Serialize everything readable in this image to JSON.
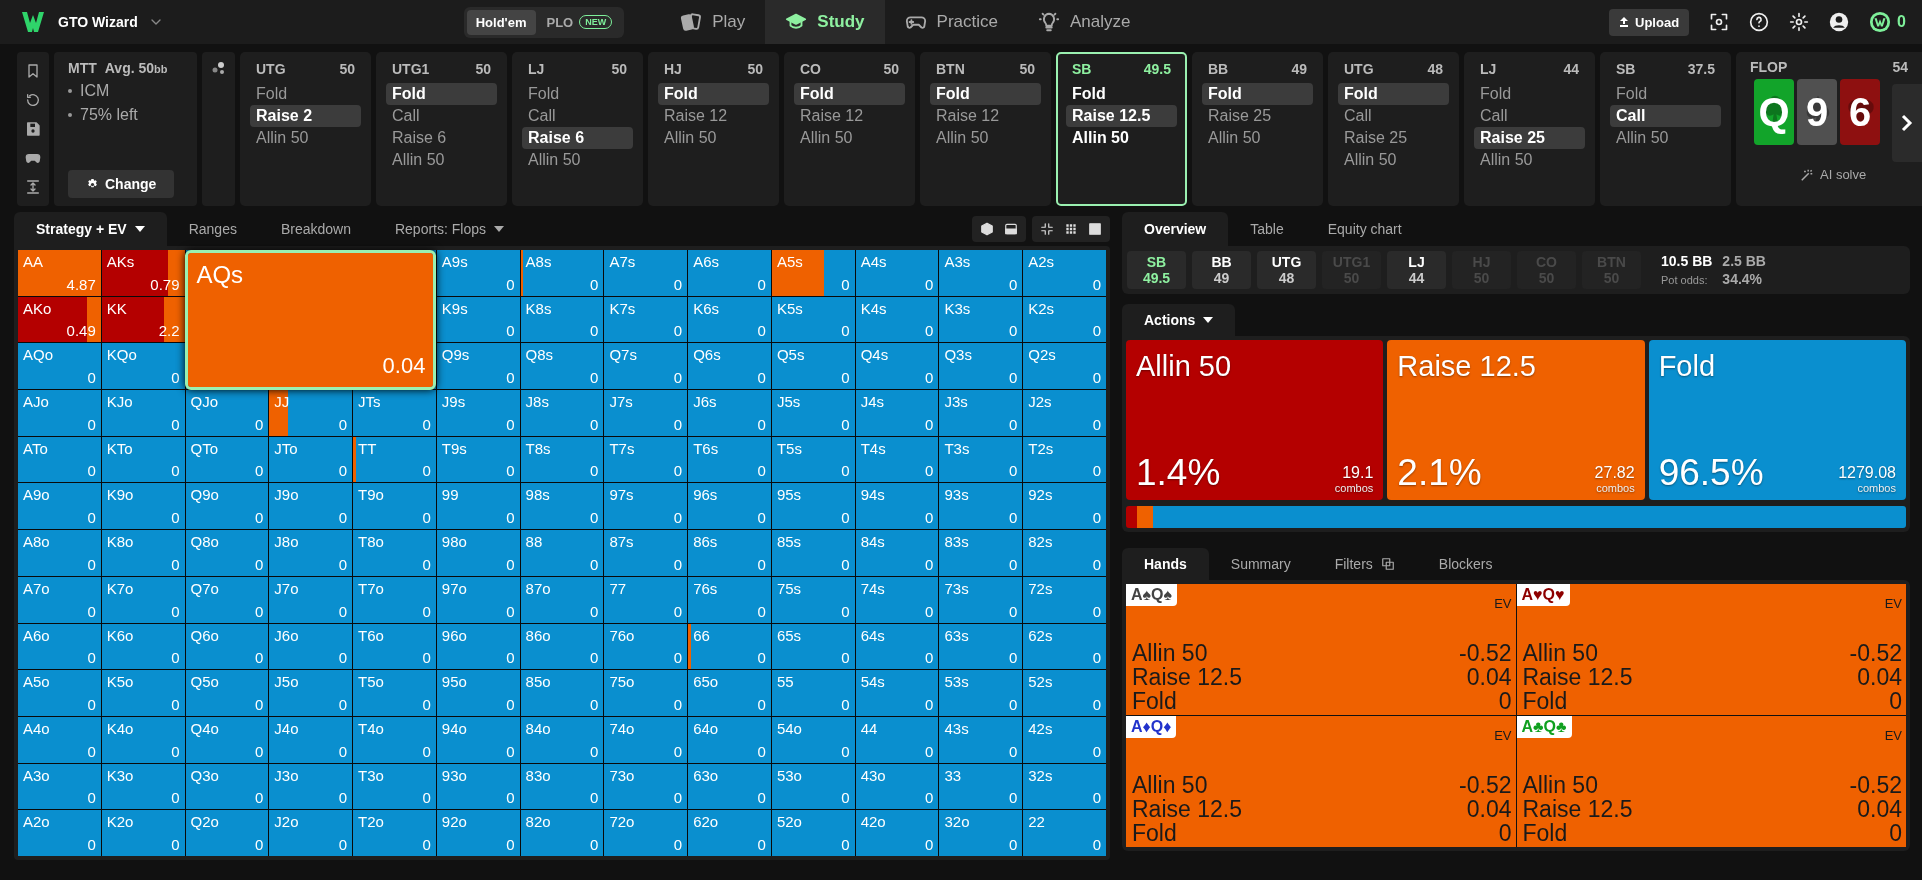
{
  "top_bar": {
    "app_name": "GTO Wizard",
    "game_toggle": [
      {
        "label": "Hold'em",
        "selected": true
      },
      {
        "label": "PLO",
        "badge": "NEW",
        "selected": false
      }
    ],
    "nav": [
      {
        "label": "Play",
        "kind": "cards",
        "selected": false
      },
      {
        "label": "Study",
        "kind": "cap",
        "selected": true
      },
      {
        "label": "Practice",
        "kind": "gamepad",
        "selected": false
      },
      {
        "label": "Analyze",
        "kind": "bulb",
        "selected": false
      }
    ],
    "upload": "Upload",
    "coins": "0"
  },
  "history": {
    "format": "MTT",
    "avg": "Avg. 50",
    "avg_unit": "bb",
    "notes": [
      "ICM",
      "75% left"
    ],
    "change_button": "Change",
    "steps": [
      {
        "position": "UTG",
        "stack": "50",
        "current": false,
        "actions": [
          {
            "label": "Fold",
            "selected": false
          },
          {
            "label": "Raise 2",
            "selected": true
          },
          {
            "label": "Allin 50",
            "selected": false
          }
        ]
      },
      {
        "position": "UTG1",
        "stack": "50",
        "current": false,
        "actions": [
          {
            "label": "Fold",
            "selected": true
          },
          {
            "label": "Call",
            "selected": false
          },
          {
            "label": "Raise 6",
            "selected": false
          },
          {
            "label": "Allin 50",
            "selected": false
          }
        ]
      },
      {
        "position": "LJ",
        "stack": "50",
        "current": false,
        "actions": [
          {
            "label": "Fold",
            "selected": false
          },
          {
            "label": "Call",
            "selected": false
          },
          {
            "label": "Raise 6",
            "selected": true
          },
          {
            "label": "Allin 50",
            "selected": false
          }
        ]
      },
      {
        "position": "HJ",
        "stack": "50",
        "current": false,
        "actions": [
          {
            "label": "Fold",
            "selected": true
          },
          {
            "label": "Raise 12",
            "selected": false
          },
          {
            "label": "Allin 50",
            "selected": false
          }
        ]
      },
      {
        "position": "CO",
        "stack": "50",
        "current": false,
        "actions": [
          {
            "label": "Fold",
            "selected": true
          },
          {
            "label": "Raise 12",
            "selected": false
          },
          {
            "label": "Allin 50",
            "selected": false
          }
        ]
      },
      {
        "position": "BTN",
        "stack": "50",
        "current": false,
        "actions": [
          {
            "label": "Fold",
            "selected": true
          },
          {
            "label": "Raise 12",
            "selected": false
          },
          {
            "label": "Allin 50",
            "selected": false
          }
        ]
      },
      {
        "position": "SB",
        "stack": "49.5",
        "current": true,
        "actions": [
          {
            "label": "Fold",
            "selected": false
          },
          {
            "label": "Raise 12.5",
            "selected": true
          },
          {
            "label": "Allin 50",
            "selected": false
          }
        ]
      },
      {
        "position": "BB",
        "stack": "49",
        "current": false,
        "actions": [
          {
            "label": "Fold",
            "selected": true
          },
          {
            "label": "Raise 25",
            "selected": false
          },
          {
            "label": "Allin 50",
            "selected": false
          }
        ]
      },
      {
        "position": "UTG",
        "stack": "48",
        "current": false,
        "actions": [
          {
            "label": "Fold",
            "selected": true
          },
          {
            "label": "Call",
            "selected": false
          },
          {
            "label": "Raise 25",
            "selected": false
          },
          {
            "label": "Allin 50",
            "selected": false
          }
        ]
      },
      {
        "position": "LJ",
        "stack": "44",
        "current": false,
        "actions": [
          {
            "label": "Fold",
            "selected": false
          },
          {
            "label": "Call",
            "selected": false
          },
          {
            "label": "Raise 25",
            "selected": true
          },
          {
            "label": "Allin 50",
            "selected": false
          }
        ]
      },
      {
        "position": "SB",
        "stack": "37.5",
        "current": false,
        "actions": [
          {
            "label": "Fold",
            "selected": false
          },
          {
            "label": "Call",
            "selected": true
          },
          {
            "label": "Allin 50",
            "selected": false
          }
        ]
      }
    ],
    "board": {
      "street": "FLOP",
      "pot": "54",
      "cards": [
        {
          "rank": "Q",
          "kind": "club",
          "color": "#12a42a"
        },
        {
          "rank": "9",
          "kind": "spade",
          "color": "#505050"
        },
        {
          "rank": "6",
          "kind": "heart",
          "color": "#8e1010"
        }
      ],
      "ai_solve": "AI solve"
    }
  },
  "left_tabs": [
    {
      "label": "Strategy + EV",
      "dropdown": true,
      "selected": true
    },
    {
      "label": "Ranges",
      "dropdown": false,
      "selected": false
    },
    {
      "label": "Breakdown",
      "dropdown": false,
      "selected": false
    },
    {
      "label": "Reports: Flops",
      "dropdown": true,
      "selected": false
    }
  ],
  "hand_grid": {
    "rows": [
      [
        {
          "hand": "AA",
          "ev": "4.87",
          "mix": [
            {
              "kind": "raise",
              "level": 1
            }
          ]
        },
        {
          "hand": "AKs",
          "ev": "0.79",
          "mix": [
            {
              "kind": "allin",
              "level": 0.8
            },
            {
              "kind": "raise",
              "level": 0.2
            }
          ]
        },
        null,
        null,
        null,
        {
          "hand": "A9s",
          "ev": "0"
        },
        {
          "hand": "A8s",
          "ev": "0",
          "mix": [
            {
              "kind": "raise",
              "level": 0.03
            }
          ]
        },
        {
          "hand": "A7s",
          "ev": "0"
        },
        {
          "hand": "A6s",
          "ev": "0"
        },
        {
          "hand": "A5s",
          "ev": "0",
          "mix": [
            {
              "kind": "raise",
              "level": 0.63
            }
          ]
        },
        {
          "hand": "A4s",
          "ev": "0"
        },
        {
          "hand": "A3s",
          "ev": "0"
        },
        {
          "hand": "A2s",
          "ev": "0"
        }
      ],
      [
        {
          "hand": "AKo",
          "ev": "0.49",
          "mix": [
            {
              "kind": "allin",
              "level": 0.83
            },
            {
              "kind": "raise",
              "level": 0.17
            }
          ]
        },
        {
          "hand": "KK",
          "ev": "2.2",
          "mix": [
            {
              "kind": "allin",
              "level": 0.75
            },
            {
              "kind": "raise",
              "level": 0.25
            }
          ]
        },
        null,
        null,
        null,
        {
          "hand": "K9s",
          "ev": "0"
        },
        {
          "hand": "K8s",
          "ev": "0"
        },
        {
          "hand": "K7s",
          "ev": "0"
        },
        {
          "hand": "K6s",
          "ev": "0"
        },
        {
          "hand": "K5s",
          "ev": "0"
        },
        {
          "hand": "K4s",
          "ev": "0"
        },
        {
          "hand": "K3s",
          "ev": "0"
        },
        {
          "hand": "K2s",
          "ev": "0"
        }
      ],
      [
        {
          "hand": "AQo",
          "ev": "0"
        },
        {
          "hand": "KQo",
          "ev": "0"
        },
        null,
        null,
        null,
        {
          "hand": "Q9s",
          "ev": "0"
        },
        {
          "hand": "Q8s",
          "ev": "0"
        },
        {
          "hand": "Q7s",
          "ev": "0"
        },
        {
          "hand": "Q6s",
          "ev": "0"
        },
        {
          "hand": "Q5s",
          "ev": "0"
        },
        {
          "hand": "Q4s",
          "ev": "0"
        },
        {
          "hand": "Q3s",
          "ev": "0"
        },
        {
          "hand": "Q2s",
          "ev": "0"
        }
      ],
      [
        {
          "hand": "AJo",
          "ev": "0"
        },
        {
          "hand": "KJo",
          "ev": "0"
        },
        {
          "hand": "QJo",
          "ev": "0"
        },
        {
          "hand": "JJ",
          "ev": "0",
          "mix": [
            {
              "kind": "raise",
              "level": 0.22
            }
          ]
        },
        {
          "hand": "JTs",
          "ev": "0"
        },
        {
          "hand": "J9s",
          "ev": "0"
        },
        {
          "hand": "J8s",
          "ev": "0"
        },
        {
          "hand": "J7s",
          "ev": "0"
        },
        {
          "hand": "J6s",
          "ev": "0"
        },
        {
          "hand": "J5s",
          "ev": "0"
        },
        {
          "hand": "J4s",
          "ev": "0"
        },
        {
          "hand": "J3s",
          "ev": "0"
        },
        {
          "hand": "J2s",
          "ev": "0"
        }
      ],
      [
        {
          "hand": "ATo",
          "ev": "0"
        },
        {
          "hand": "KTo",
          "ev": "0"
        },
        {
          "hand": "QTo",
          "ev": "0"
        },
        {
          "hand": "JTo",
          "ev": "0"
        },
        {
          "hand": "TT",
          "ev": "0",
          "mix": [
            {
              "kind": "raise",
              "level": 0.03
            }
          ]
        },
        {
          "hand": "T9s",
          "ev": "0"
        },
        {
          "hand": "T8s",
          "ev": "0"
        },
        {
          "hand": "T7s",
          "ev": "0"
        },
        {
          "hand": "T6s",
          "ev": "0"
        },
        {
          "hand": "T5s",
          "ev": "0"
        },
        {
          "hand": "T4s",
          "ev": "0"
        },
        {
          "hand": "T3s",
          "ev": "0"
        },
        {
          "hand": "T2s",
          "ev": "0"
        }
      ],
      [
        {
          "hand": "A9o",
          "ev": "0"
        },
        {
          "hand": "K9o",
          "ev": "0"
        },
        {
          "hand": "Q9o",
          "ev": "0"
        },
        {
          "hand": "J9o",
          "ev": "0"
        },
        {
          "hand": "T9o",
          "ev": "0"
        },
        {
          "hand": "99",
          "ev": "0"
        },
        {
          "hand": "98s",
          "ev": "0"
        },
        {
          "hand": "97s",
          "ev": "0"
        },
        {
          "hand": "96s",
          "ev": "0"
        },
        {
          "hand": "95s",
          "ev": "0"
        },
        {
          "hand": "94s",
          "ev": "0"
        },
        {
          "hand": "93s",
          "ev": "0"
        },
        {
          "hand": "92s",
          "ev": "0"
        }
      ],
      [
        {
          "hand": "A8o",
          "ev": "0"
        },
        {
          "hand": "K8o",
          "ev": "0"
        },
        {
          "hand": "Q8o",
          "ev": "0"
        },
        {
          "hand": "J8o",
          "ev": "0"
        },
        {
          "hand": "T8o",
          "ev": "0"
        },
        {
          "hand": "98o",
          "ev": "0"
        },
        {
          "hand": "88",
          "ev": "0"
        },
        {
          "hand": "87s",
          "ev": "0"
        },
        {
          "hand": "86s",
          "ev": "0"
        },
        {
          "hand": "85s",
          "ev": "0"
        },
        {
          "hand": "84s",
          "ev": "0"
        },
        {
          "hand": "83s",
          "ev": "0"
        },
        {
          "hand": "82s",
          "ev": "0"
        }
      ],
      [
        {
          "hand": "A7o",
          "ev": "0"
        },
        {
          "hand": "K7o",
          "ev": "0"
        },
        {
          "hand": "Q7o",
          "ev": "0"
        },
        {
          "hand": "J7o",
          "ev": "0"
        },
        {
          "hand": "T7o",
          "ev": "0"
        },
        {
          "hand": "97o",
          "ev": "0"
        },
        {
          "hand": "87o",
          "ev": "0"
        },
        {
          "hand": "77",
          "ev": "0"
        },
        {
          "hand": "76s",
          "ev": "0"
        },
        {
          "hand": "75s",
          "ev": "0"
        },
        {
          "hand": "74s",
          "ev": "0"
        },
        {
          "hand": "73s",
          "ev": "0"
        },
        {
          "hand": "72s",
          "ev": "0"
        }
      ],
      [
        {
          "hand": "A6o",
          "ev": "0"
        },
        {
          "hand": "K6o",
          "ev": "0"
        },
        {
          "hand": "Q6o",
          "ev": "0"
        },
        {
          "hand": "J6o",
          "ev": "0"
        },
        {
          "hand": "T6o",
          "ev": "0"
        },
        {
          "hand": "96o",
          "ev": "0"
        },
        {
          "hand": "86o",
          "ev": "0"
        },
        {
          "hand": "76o",
          "ev": "0"
        },
        {
          "hand": "66",
          "ev": "0",
          "mix": [
            {
              "kind": "raise",
              "level": 0.03
            }
          ]
        },
        {
          "hand": "65s",
          "ev": "0"
        },
        {
          "hand": "64s",
          "ev": "0"
        },
        {
          "hand": "63s",
          "ev": "0"
        },
        {
          "hand": "62s",
          "ev": "0"
        }
      ],
      [
        {
          "hand": "A5o",
          "ev": "0"
        },
        {
          "hand": "K5o",
          "ev": "0"
        },
        {
          "hand": "Q5o",
          "ev": "0"
        },
        {
          "hand": "J5o",
          "ev": "0"
        },
        {
          "hand": "T5o",
          "ev": "0"
        },
        {
          "hand": "95o",
          "ev": "0"
        },
        {
          "hand": "85o",
          "ev": "0"
        },
        {
          "hand": "75o",
          "ev": "0"
        },
        {
          "hand": "65o",
          "ev": "0"
        },
        {
          "hand": "55",
          "ev": "0"
        },
        {
          "hand": "54s",
          "ev": "0"
        },
        {
          "hand": "53s",
          "ev": "0"
        },
        {
          "hand": "52s",
          "ev": "0"
        }
      ],
      [
        {
          "hand": "A4o",
          "ev": "0"
        },
        {
          "hand": "K4o",
          "ev": "0"
        },
        {
          "hand": "Q4o",
          "ev": "0"
        },
        {
          "hand": "J4o",
          "ev": "0"
        },
        {
          "hand": "T4o",
          "ev": "0"
        },
        {
          "hand": "94o",
          "ev": "0"
        },
        {
          "hand": "84o",
          "ev": "0"
        },
        {
          "hand": "74o",
          "ev": "0"
        },
        {
          "hand": "64o",
          "ev": "0"
        },
        {
          "hand": "54o",
          "ev": "0"
        },
        {
          "hand": "44",
          "ev": "0"
        },
        {
          "hand": "43s",
          "ev": "0"
        },
        {
          "hand": "42s",
          "ev": "0"
        }
      ],
      [
        {
          "hand": "A3o",
          "ev": "0"
        },
        {
          "hand": "K3o",
          "ev": "0"
        },
        {
          "hand": "Q3o",
          "ev": "0"
        },
        {
          "hand": "J3o",
          "ev": "0"
        },
        {
          "hand": "T3o",
          "ev": "0"
        },
        {
          "hand": "93o",
          "ev": "0"
        },
        {
          "hand": "83o",
          "ev": "0"
        },
        {
          "hand": "73o",
          "ev": "0"
        },
        {
          "hand": "63o",
          "ev": "0"
        },
        {
          "hand": "53o",
          "ev": "0"
        },
        {
          "hand": "43o",
          "ev": "0"
        },
        {
          "hand": "33",
          "ev": "0"
        },
        {
          "hand": "32s",
          "ev": "0"
        }
      ],
      [
        {
          "hand": "A2o",
          "ev": "0"
        },
        {
          "hand": "K2o",
          "ev": "0"
        },
        {
          "hand": "Q2o",
          "ev": "0"
        },
        {
          "hand": "J2o",
          "ev": "0"
        },
        {
          "hand": "T2o",
          "ev": "0"
        },
        {
          "hand": "92o",
          "ev": "0"
        },
        {
          "hand": "82o",
          "ev": "0"
        },
        {
          "hand": "72o",
          "ev": "0"
        },
        {
          "hand": "62o",
          "ev": "0"
        },
        {
          "hand": "52o",
          "ev": "0"
        },
        {
          "hand": "42o",
          "ev": "0"
        },
        {
          "hand": "32o",
          "ev": "0"
        },
        {
          "hand": "22",
          "ev": "0"
        }
      ]
    ],
    "popup": {
      "hand": "AQs",
      "ev": "0.04",
      "mix": [
        {
          "kind": "raise",
          "level": 1
        }
      ]
    }
  },
  "right_tabs": [
    {
      "label": "Overview",
      "selected": true
    },
    {
      "label": "Table",
      "selected": false
    },
    {
      "label": "Equity chart",
      "selected": false
    }
  ],
  "players": [
    {
      "position": "SB",
      "stack": "49.5",
      "active": true,
      "folded": false
    },
    {
      "position": "BB",
      "stack": "49",
      "active": false,
      "folded": false
    },
    {
      "position": "UTG",
      "stack": "48",
      "active": false,
      "folded": false
    },
    {
      "position": "UTG1",
      "stack": "50",
      "active": false,
      "folded": true
    },
    {
      "position": "LJ",
      "stack": "44",
      "active": false,
      "folded": false
    },
    {
      "position": "HJ",
      "stack": "50",
      "active": false,
      "folded": true
    },
    {
      "position": "CO",
      "stack": "50",
      "active": false,
      "folded": true
    },
    {
      "position": "BTN",
      "stack": "50",
      "active": false,
      "folded": true
    }
  ],
  "pot": "10.5 BB",
  "to_call": "2.5 BB",
  "pot_odds_label": "Pot odds:",
  "pot_odds": "34.4%",
  "actions_tab": "Actions",
  "actions": [
    {
      "label": "Allin 50",
      "percent": "1.4%",
      "combos": "19.1",
      "combos_label": "combos",
      "color": "#b40000"
    },
    {
      "label": "Raise 12.5",
      "percent": "2.1%",
      "combos": "27.82",
      "combos_label": "combos",
      "color": "#ef6100"
    },
    {
      "label": "Fold",
      "percent": "96.5%",
      "combos": "1279.08",
      "combos_label": "combos",
      "color": "#0a8fcf"
    }
  ],
  "strategy_bar": [
    {
      "kind": "allin",
      "level": 0.014
    },
    {
      "kind": "raise",
      "level": 0.021
    },
    {
      "kind": "fold",
      "level": 0.965
    }
  ],
  "hand_tabs": [
    {
      "label": "Hands",
      "selected": true,
      "has_icon": false
    },
    {
      "label": "Summary",
      "selected": false,
      "has_icon": false
    },
    {
      "label": "Filters",
      "selected": false,
      "has_icon": true
    },
    {
      "label": "Blockers",
      "selected": false,
      "has_icon": false
    }
  ],
  "hand_cards": [
    {
      "combo": "A♠Q♠",
      "color": "#444444",
      "ev_label": "EV",
      "rows": [
        {
          "action": "Allin 50",
          "ev": "-0.52"
        },
        {
          "action": "Raise 12.5",
          "ev": "0.04"
        },
        {
          "action": "Fold",
          "ev": "0"
        }
      ]
    },
    {
      "combo": "A♥Q♥",
      "color": "#8e0000",
      "ev_label": "EV",
      "rows": [
        {
          "action": "Allin 50",
          "ev": "-0.52"
        },
        {
          "action": "Raise 12.5",
          "ev": "0.04"
        },
        {
          "action": "Fold",
          "ev": "0"
        }
      ]
    },
    {
      "combo": "A♦Q♦",
      "color": "#2233cc",
      "ev_label": "EV",
      "rows": [
        {
          "action": "Allin 50",
          "ev": "-0.52"
        },
        {
          "action": "Raise 12.5",
          "ev": "0.04"
        },
        {
          "action": "Fold",
          "ev": "0"
        }
      ]
    },
    {
      "combo": "A♣Q♣",
      "color": "#10a020",
      "ev_label": "EV",
      "rows": [
        {
          "action": "Allin 50",
          "ev": "-0.52"
        },
        {
          "action": "Raise 12.5",
          "ev": "0.04"
        },
        {
          "action": "Fold",
          "ev": "0"
        }
      ]
    }
  ]
}
